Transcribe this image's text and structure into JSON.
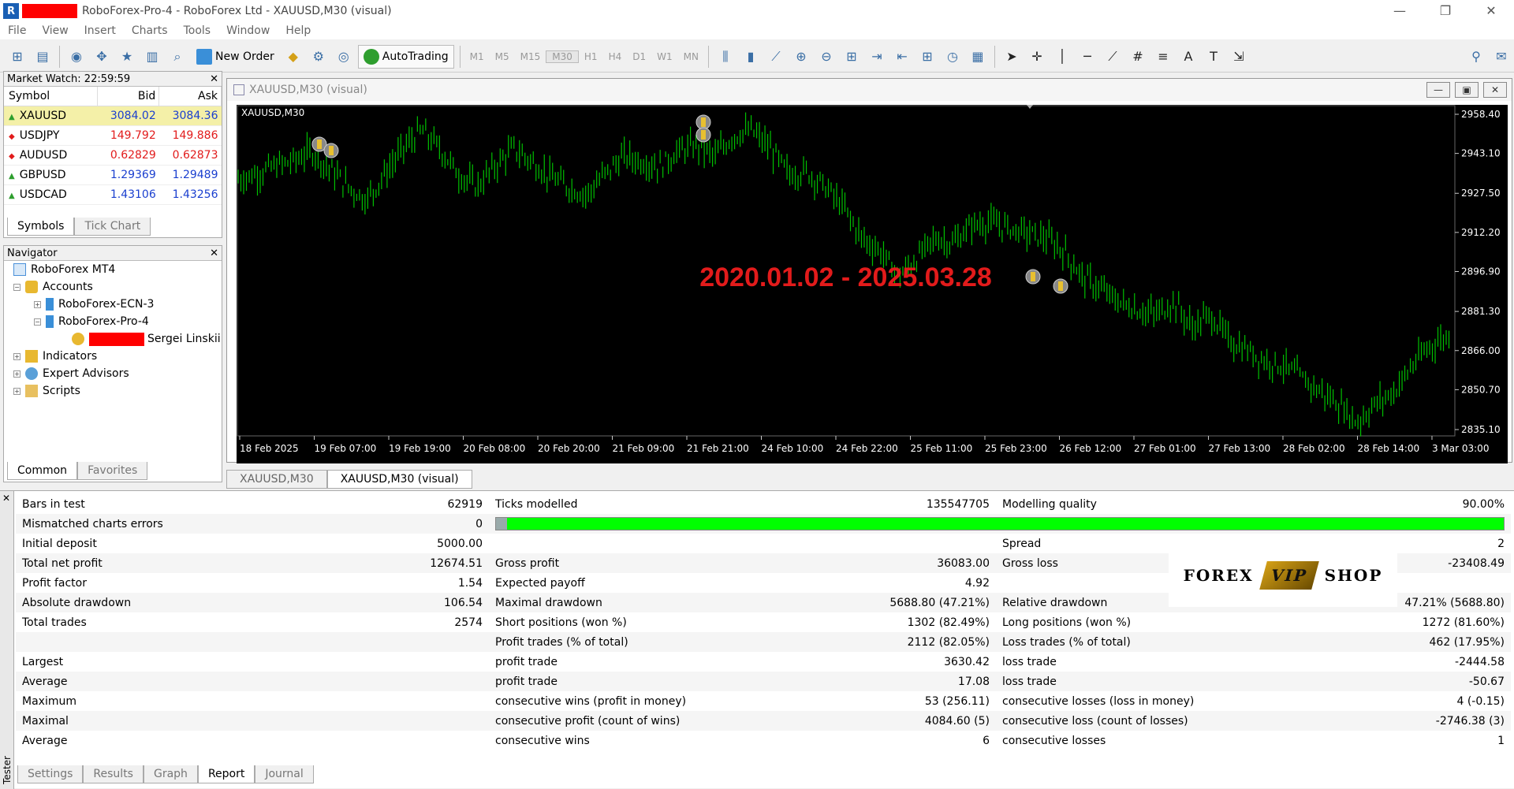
{
  "window": {
    "title": "RoboForex-Pro-4 - RoboForex Ltd - XAUUSD,M30 (visual)",
    "buttons": [
      "—",
      "❐",
      "✕"
    ]
  },
  "menu": [
    "File",
    "View",
    "Insert",
    "Charts",
    "Tools",
    "Window",
    "Help"
  ],
  "toolbar": {
    "new_order": "New Order",
    "autotrading": "AutoTrading",
    "timeframes": [
      "M1",
      "M5",
      "M15",
      "M30",
      "H1",
      "H4",
      "D1",
      "W1",
      "MN"
    ],
    "active_tf": "M30"
  },
  "market_watch": {
    "title": "Market Watch: 22:59:59",
    "columns": [
      "Symbol",
      "Bid",
      "Ask"
    ],
    "rows": [
      {
        "symbol": "XAUUSD",
        "bid": "3084.02",
        "ask": "3084.36",
        "dir": "up",
        "color": "#1a3fcf"
      },
      {
        "symbol": "USDJPY",
        "bid": "149.792",
        "ask": "149.886",
        "dir": "down",
        "color": "#e21b1b"
      },
      {
        "symbol": "AUDUSD",
        "bid": "0.62829",
        "ask": "0.62873",
        "dir": "down",
        "color": "#e21b1b"
      },
      {
        "symbol": "GBPUSD",
        "bid": "1.29369",
        "ask": "1.29489",
        "dir": "up",
        "color": "#1a3fcf"
      },
      {
        "symbol": "USDCAD",
        "bid": "1.43106",
        "ask": "1.43256",
        "dir": "up",
        "color": "#1a3fcf"
      }
    ],
    "tabs": [
      "Symbols",
      "Tick Chart"
    ]
  },
  "navigator": {
    "title": "Navigator",
    "root": "RoboForex MT4",
    "accounts": "Accounts",
    "acc1": "RoboForex-ECN-3",
    "acc2": "RoboForex-Pro-4",
    "user": "Sergei Linskii",
    "indicators": "Indicators",
    "experts": "Expert Advisors",
    "scripts": "Scripts",
    "tabs": [
      "Common",
      "Favorites"
    ]
  },
  "chart": {
    "window_title": "XAUUSD,M30 (visual)",
    "label": "XAUUSD,M30",
    "overlay": "2020.01.02 - 2025.03.28",
    "price_ticks": [
      "2958.40",
      "2943.10",
      "2927.50",
      "2912.20",
      "2896.90",
      "2881.30",
      "2866.00",
      "2850.70",
      "2835.10"
    ],
    "time_ticks": [
      "18 Feb 2025",
      "19 Feb 07:00",
      "19 Feb 19:00",
      "20 Feb 08:00",
      "20 Feb 20:00",
      "21 Feb 09:00",
      "21 Feb 21:00",
      "24 Feb 10:00",
      "24 Feb 22:00",
      "25 Feb 11:00",
      "25 Feb 23:00",
      "26 Feb 12:00",
      "27 Feb 01:00",
      "27 Feb 13:00",
      "28 Feb 02:00",
      "28 Feb 14:00",
      "3 Mar 03:00"
    ],
    "price_path": [
      2933,
      2935,
      2938,
      2940,
      2944,
      2937,
      2930,
      2925,
      2935,
      2945,
      2952,
      2945,
      2935,
      2930,
      2938,
      2945,
      2940,
      2934,
      2930,
      2927,
      2935,
      2942,
      2940,
      2938,
      2944,
      2946,
      2942,
      2950,
      2952,
      2945,
      2935,
      2936,
      2930,
      2922,
      2910,
      2905,
      2895,
      2902,
      2910,
      2908,
      2915,
      2916,
      2914,
      2912,
      2910,
      2905,
      2895,
      2890,
      2885,
      2882,
      2880,
      2885,
      2875,
      2880,
      2870,
      2866,
      2862,
      2860,
      2855,
      2850,
      2845,
      2838,
      2845,
      2850,
      2860,
      2868,
      2872
    ],
    "line_color": "#00c000",
    "bg": "#000000"
  },
  "doc_tabs": [
    "XAUUSD,M30",
    "XAUUSD,M30 (visual)"
  ],
  "report": {
    "rows": [
      [
        "Bars in test",
        "62919",
        "Ticks modelled",
        "135547705",
        "Modelling quality",
        "90.00%"
      ],
      [
        "Mismatched charts errors",
        "0",
        "",
        "",
        "",
        ""
      ],
      [
        "Initial deposit",
        "5000.00",
        "",
        "",
        "Spread",
        "2"
      ],
      [
        "Total net profit",
        "12674.51",
        "Gross profit",
        "36083.00",
        "Gross loss",
        "-23408.49"
      ],
      [
        "Profit factor",
        "1.54",
        "Expected payoff",
        "4.92",
        "",
        ""
      ],
      [
        "Absolute drawdown",
        "106.54",
        "Maximal drawdown",
        "5688.80 (47.21%)",
        "Relative drawdown",
        "47.21% (5688.80)"
      ],
      [
        "Total trades",
        "2574",
        "Short positions (won %)",
        "1302 (82.49%)",
        "Long positions (won %)",
        "1272 (81.60%)"
      ],
      [
        "",
        "",
        "Profit trades (% of total)",
        "2112 (82.05%)",
        "Loss trades (% of total)",
        "462 (17.95%)"
      ],
      [
        "Largest",
        "",
        "profit trade",
        "3630.42",
        "loss trade",
        "-2444.58"
      ],
      [
        "Average",
        "",
        "profit trade",
        "17.08",
        "loss trade",
        "-50.67"
      ],
      [
        "Maximum",
        "",
        "consecutive wins (profit in money)",
        "53 (256.11)",
        "consecutive losses (loss in money)",
        "4 (-0.15)"
      ],
      [
        "Maximal",
        "",
        "consecutive profit (count of wins)",
        "4084.60 (5)",
        "consecutive loss (count of losses)",
        "-2746.38 (3)"
      ],
      [
        "Average",
        "",
        "consecutive wins",
        "6",
        "consecutive losses",
        "1"
      ]
    ],
    "quality_bar": 0.99
  },
  "bottom_tabs": [
    "Settings",
    "Results",
    "Graph",
    "Report",
    "Journal"
  ],
  "active_bottom": "Report",
  "side_label": "Tester",
  "logo": {
    "left": "FOREX",
    "mid": "VIP",
    "right": "SHOP"
  }
}
